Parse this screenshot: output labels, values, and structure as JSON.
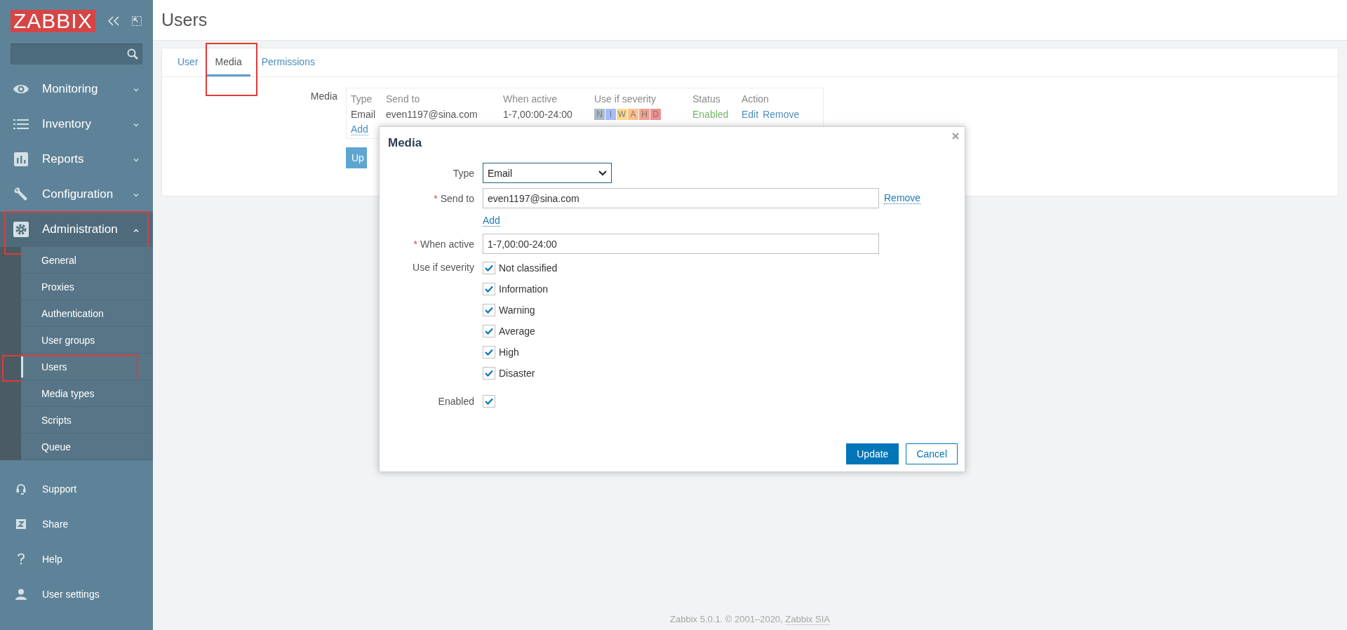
{
  "sidebar": {
    "logo": "ZABBIX",
    "nav": [
      {
        "label": "Monitoring",
        "expanded": false,
        "highlighted": false
      },
      {
        "label": "Inventory",
        "expanded": false,
        "highlighted": false
      },
      {
        "label": "Reports",
        "expanded": false,
        "highlighted": false
      },
      {
        "label": "Configuration",
        "expanded": false,
        "highlighted": false
      },
      {
        "label": "Administration",
        "expanded": true,
        "highlighted": true,
        "children": [
          {
            "label": "General",
            "selected": false,
            "highlighted": false
          },
          {
            "label": "Proxies",
            "selected": false,
            "highlighted": false
          },
          {
            "label": "Authentication",
            "selected": false,
            "highlighted": false
          },
          {
            "label": "User groups",
            "selected": false,
            "highlighted": false
          },
          {
            "label": "Users",
            "selected": true,
            "highlighted": true
          },
          {
            "label": "Media types",
            "selected": false,
            "highlighted": false
          },
          {
            "label": "Scripts",
            "selected": false,
            "highlighted": false
          },
          {
            "label": "Queue",
            "selected": false,
            "highlighted": false
          }
        ]
      }
    ],
    "bottom_nav": [
      {
        "label": "Support"
      },
      {
        "label": "Share"
      },
      {
        "label": "Help"
      },
      {
        "label": "User settings"
      }
    ]
  },
  "page_title": "Users",
  "tabs": [
    {
      "label": "User",
      "selected": false,
      "highlighted": false
    },
    {
      "label": "Media",
      "selected": true,
      "highlighted": true
    },
    {
      "label": "Permissions",
      "selected": false,
      "highlighted": false
    }
  ],
  "media": {
    "label": "Media",
    "columns": [
      "Type",
      "Send to",
      "When active",
      "Use if severity",
      "Status",
      "Action"
    ],
    "rows": [
      {
        "type": "Email",
        "send_to": "even1197@sina.com",
        "when_active": "1-7,00:00-24:00",
        "severities": [
          {
            "letter": "N",
            "color": "#a9bac3"
          },
          {
            "letter": "I",
            "color": "#a3bcff"
          },
          {
            "letter": "W",
            "color": "#ffd98f"
          },
          {
            "letter": "A",
            "color": "#ffc090"
          },
          {
            "letter": "H",
            "color": "#f0a28e"
          },
          {
            "letter": "D",
            "color": "#ee9090"
          }
        ],
        "status": "Enabled",
        "actions": [
          "Edit",
          "Remove"
        ]
      }
    ],
    "add_link": "Add",
    "button": "Up"
  },
  "dialog": {
    "title": "Media",
    "type_label": "Type",
    "type_value": "Email",
    "send_to": {
      "required_mark": "*",
      "label": "Send to",
      "value": "even1197@sina.com",
      "remove": "Remove",
      "add": "Add"
    },
    "when_active": {
      "required_mark": "*",
      "label": "When active",
      "value": "1-7,00:00-24:00"
    },
    "severity_label": "Use if severity",
    "severities": [
      {
        "label": "Not classified",
        "checked": true
      },
      {
        "label": "Information",
        "checked": true
      },
      {
        "label": "Warning",
        "checked": true
      },
      {
        "label": "Average",
        "checked": true
      },
      {
        "label": "High",
        "checked": true
      },
      {
        "label": "Disaster",
        "checked": true
      }
    ],
    "enabled_label": "Enabled",
    "enabled": true,
    "buttons": [
      {
        "label": "Update",
        "kind": "primary"
      },
      {
        "label": "Cancel",
        "kind": "secondary"
      }
    ]
  },
  "footer": {
    "text": "Zabbix 5.0.1. © 2001–2020, ",
    "link": "Zabbix SIA"
  }
}
